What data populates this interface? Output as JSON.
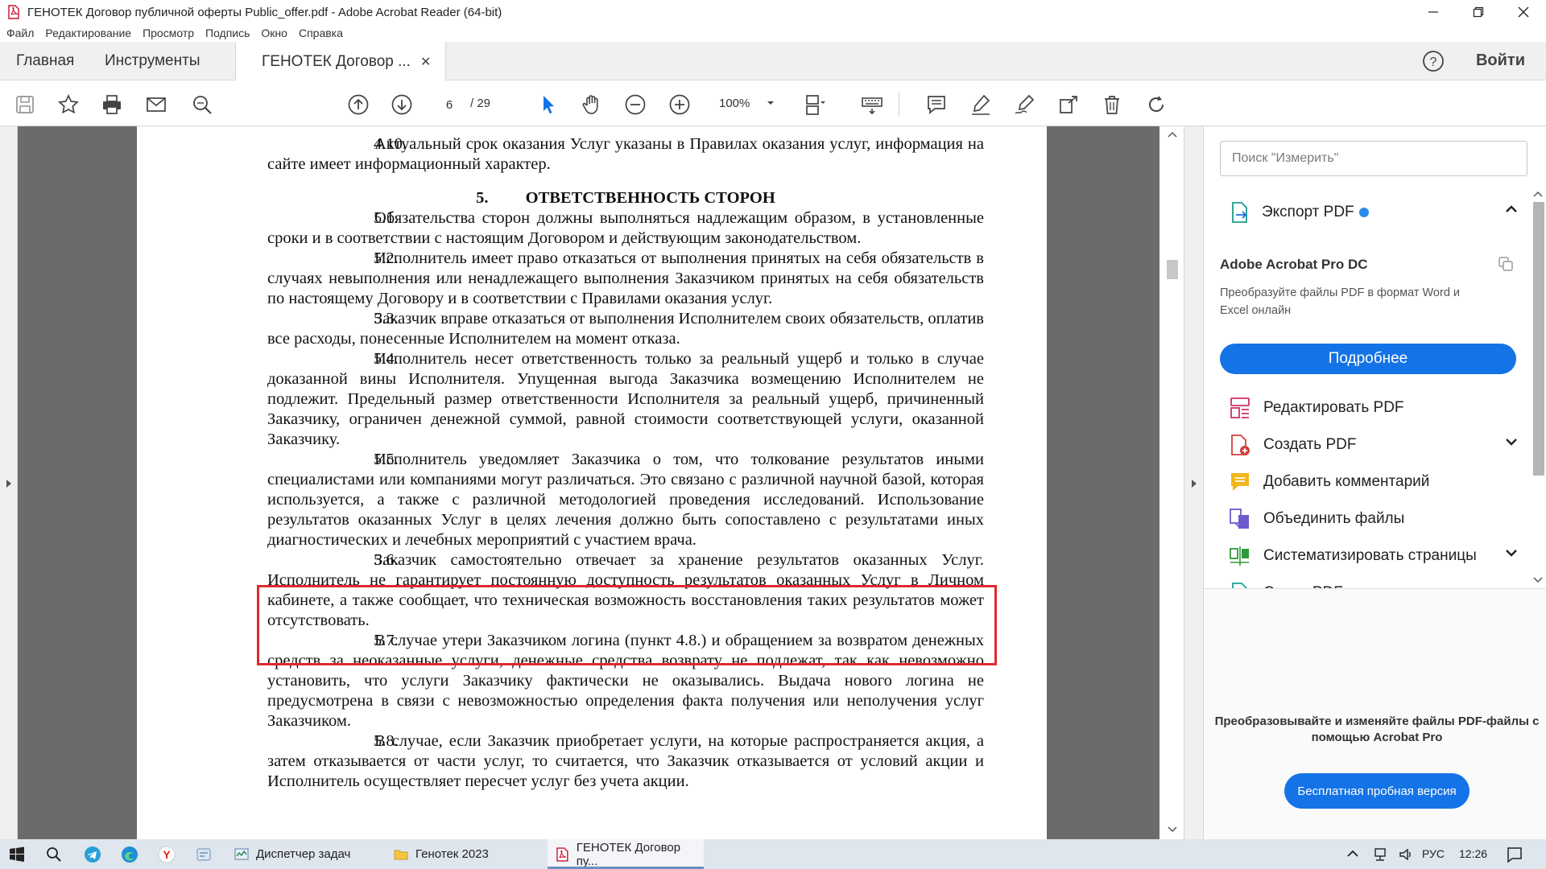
{
  "window": {
    "title": "ГЕНОТЕК Договор публичной оферты Public_offer.pdf - Adobe Acrobat Reader (64-bit)"
  },
  "menu": [
    "Файл",
    "Редактирование",
    "Просмотр",
    "Подпись",
    "Окно",
    "Справка"
  ],
  "tabs": {
    "home": "Главная",
    "tools": "Инструменты",
    "document": "ГЕНОТЕК Договор ...",
    "signin": "Войти"
  },
  "toolbar": {
    "current_page": "6",
    "total_pages": "/ 29",
    "zoom": "100%"
  },
  "document": {
    "lines": [
      "4.10. Актуальный срок оказания Услуг указаны в Правилах оказания услуг, информация на сайте имеет информационный характер."
    ],
    "p410_num": "4.10.",
    "p410_text": "Актуальный срок оказания Услуг указаны в Правилах оказания услуг, информация на сайте имеет информационный характер.",
    "section_num": "5.",
    "section_title": "ОТВЕТСТВЕННОСТЬ СТОРОН",
    "p51_num": "5.1.",
    "p51_text": "Обязательства сторон должны выполняться надлежащим образом, в установленные сроки и в соответствии с настоящим Договором и действующим законодательством.",
    "p52_num": "5.2.",
    "p52_text": "Исполнитель имеет право отказаться от выполнения принятых на себя обязательств в случаях невыполнения или ненадлежащего выполнения Заказчиком принятых на себя обязательств по настоящему Договору и в соответствии с Правилами оказания услуг.",
    "p53_num": "5.3.",
    "p53_text": "Заказчик вправе отказаться от выполнения Исполнителем своих обязательств, оплатив все расходы, понесенные Исполнителем на момент отказа.",
    "p54_num": "5.4.",
    "p54_text": "Исполнитель несет ответственность только за реальный ущерб и только в случае доказанной вины Исполнителя. Упущенная выгода Заказчика возмещению Исполнителем не подлежит. Предельный размер ответственности Исполнителя за реальный ущерб, причиненный Заказчику, ограничен денежной суммой, равной стоимости соответствующей услуги, оказанной Заказчику.",
    "p55_num": "5.5.",
    "p55_text": "Исполнитель уведомляет Заказчика о том, что толкование результатов иными специалистами или компаниями могут различаться. Это связано с различной научной базой, которая используется, а также с различной методологией проведения исследований. Использование результатов оказанных Услуг в целях лечения должно быть сопоставлено с результатами иных диагностических и лечебных мероприятий с участием врача.",
    "p56_num": "5.6.",
    "p56_text": "Заказчик самостоятельно отвечает за хранение результатов оказанных Услуг. Исполнитель не гарантирует постоянную доступность результатов оказанных Услуг в Личном кабинете, а также сообщает, что техническая возможность восстановления таких результатов может отсутствовать.",
    "p57_num": "5.7.",
    "p57_text": "В случае утери Заказчиком логина (пункт 4.8.) и обращением за возвратом денежных средств за неоказанные услуги, денежные средства возврату не подлежат, так как невозможно установить, что услуги Заказчику фактически не оказывались. Выдача нового логина не предусмотрена в связи с невозможностью определения факта получения или неполучения услуг Заказчиком.",
    "p58_num": "5.8.",
    "p58_text": "В случае, если Заказчик приобретает услуги, на которые распространяется акция, а затем отказывается от части услуг, то считается, что Заказчик отказывается от условий акции и Исполнитель осуществляет пересчет услуг без учета акции."
  },
  "right_pane": {
    "search_placeholder": "Поиск \"Измерить\"",
    "export_label": "Экспорт PDF",
    "promo_title": "Adobe Acrobat Pro DC",
    "promo_desc": "Преобразуйте файлы PDF в формат Word и Excel онлайн",
    "more_button": "Подробнее",
    "tools": [
      {
        "label": "Редактировать PDF",
        "icon": "edit-pdf-icon"
      },
      {
        "label": "Создать PDF",
        "icon": "create-pdf-icon"
      },
      {
        "label": "Добавить комментарий",
        "icon": "comment-icon"
      },
      {
        "label": "Объединить файлы",
        "icon": "combine-files-icon"
      },
      {
        "label": "Систематизировать страницы",
        "icon": "organize-pages-icon"
      },
      {
        "label": "Сжать PDF",
        "icon": "compress-pdf-icon"
      }
    ],
    "footer_text": "Преобразовывайте и изменяйте файлы PDF-файлы с помощью Acrobat Pro",
    "trial_button": "Бесплатная пробная версия"
  },
  "taskbar": {
    "apps": [
      {
        "label": "Диспетчер задач"
      },
      {
        "label": "Генотек 2023"
      },
      {
        "label": "ГЕНОТЕК Договор пу..."
      }
    ],
    "lang": "РУС",
    "time": "12:26"
  },
  "colors": {
    "accent_blue": "#1473e6",
    "highlight_red": "#e0282f"
  }
}
